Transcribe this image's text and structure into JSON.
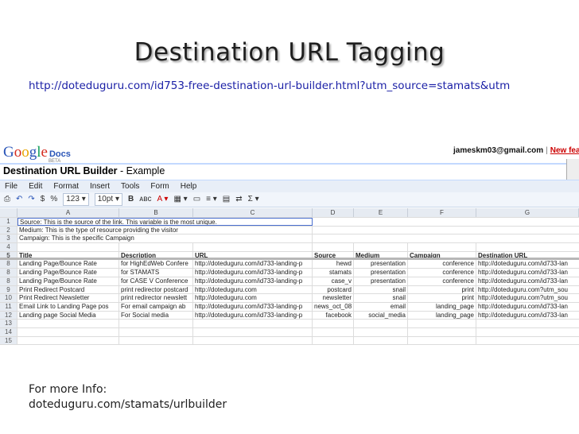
{
  "slide": {
    "title": "Destination URL Tagging",
    "url": "http://doteduguru.com/id753-free-destination-url-builder.html?utm_source=stamats&utm",
    "info_line1": "For more Info:",
    "info_line2": "doteduguru.com/stamats/urlbuilder"
  },
  "screenshot": {
    "logo_google": "Google",
    "logo_docs": "Docs",
    "logo_beta": "BETA",
    "account_email": "jameskm03@gmail.com",
    "account_sep": "|",
    "account_link": "New fea",
    "doc_title": "Destination URL Builder",
    "doc_title_suffix": " - Example",
    "menu": [
      "File",
      "Edit",
      "Format",
      "Insert",
      "Tools",
      "Form",
      "Help"
    ],
    "toolbar": [
      "⎙",
      "↶",
      "↷",
      "$",
      "%",
      "123 ▾",
      "10pt ▾",
      "B",
      "ᴀʙᴄ",
      "A ▾",
      "▦ ▾",
      "▭",
      "≡ ▾",
      "▤",
      "⇄",
      "Σ ▾"
    ],
    "columns": [
      "A",
      "B",
      "C",
      "D",
      "E",
      "F",
      "G"
    ],
    "notes": [
      {
        "n": "1",
        "text": "Source: This is the source of the link. This variable is the most unique."
      },
      {
        "n": "2",
        "text": "Medium: This is the type of resource providing the visitor"
      },
      {
        "n": "3",
        "text": "Campaign: This is the specific Campaign"
      }
    ],
    "empty_row4": "4",
    "header_row": {
      "n": "5",
      "cells": [
        "Title",
        "Description",
        "URL",
        "Source",
        "Medium",
        "Campaign",
        "Destination URL"
      ]
    },
    "rows": [
      {
        "n": "8",
        "cells": [
          "Landing Page/Bounce Rate",
          "for HighEdWeb Confere",
          "http://doteduguru.com/id733-landing-p",
          "hewd",
          "presentation",
          "conference",
          "http://doteduguru.com/id733-lan"
        ]
      },
      {
        "n": "8",
        "cells": [
          "Landing Page/Bounce Rate",
          "for STAMATS",
          "http://doteduguru.com/id733-landing-p",
          "stamats",
          "presentation",
          "conference",
          "http://doteduguru.com/id733-lan"
        ]
      },
      {
        "n": "8",
        "cells": [
          "Landing Page/Bounce Rate",
          "for CASE V Conference",
          "http://doteduguru.com/id733-landing-p",
          "case_v",
          "presentation",
          "conference",
          "http://doteduguru.com/id733-lan"
        ]
      },
      {
        "n": "9",
        "cells": [
          "Print Redirect Postcard",
          "print redirector postcard",
          "http://doteduguru.com",
          "postcard",
          "snail",
          "print",
          "http://doteduguru.com?utm_sou"
        ]
      },
      {
        "n": "10",
        "cells": [
          "Print Redirect Newsletter",
          "print redirector newslett",
          "http://doteduguru.com",
          "newsletter",
          "snail",
          "print",
          "http://doteduguru.com?utm_sou"
        ]
      },
      {
        "n": "11",
        "cells": [
          "Email Link to Landing Page pos",
          "For email campaign ab",
          "http://doteduguru.com/id733-landing-p",
          "news_oct_08",
          "email",
          "landing_page",
          "http://doteduguru.com/id733-lan"
        ]
      },
      {
        "n": "12",
        "cells": [
          "Landing page Social Media",
          "For Social media",
          "http://doteduguru.com/id733-landing-p",
          "facebook",
          "social_media",
          "landing_page",
          "http://doteduguru.com/id733-lan"
        ]
      },
      {
        "n": "13",
        "cells": [
          "",
          "",
          "",
          "",
          "",
          "",
          ""
        ]
      },
      {
        "n": "14",
        "cells": [
          "",
          "",
          "",
          "",
          "",
          "",
          ""
        ]
      },
      {
        "n": "15",
        "cells": [
          "",
          "",
          "",
          "",
          "",
          "",
          ""
        ]
      }
    ]
  }
}
